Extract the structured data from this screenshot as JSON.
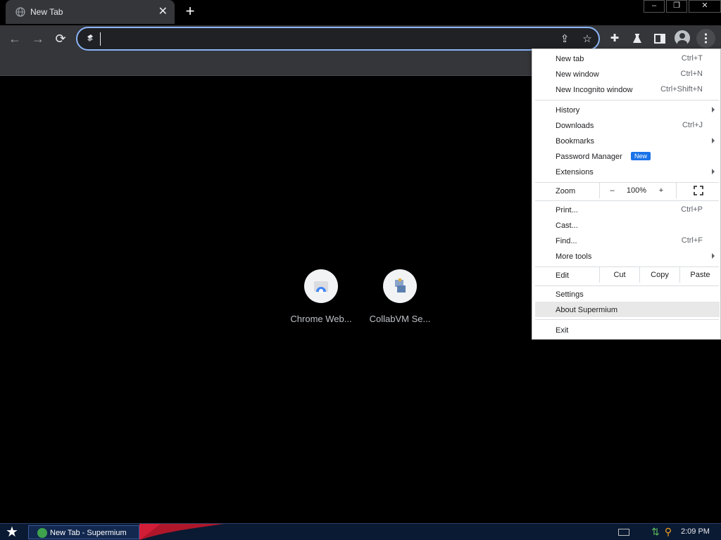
{
  "tab": {
    "title": "New Tab",
    "close": "✕"
  },
  "new_tab_plus": "+",
  "window_controls": {
    "minimize": "–",
    "restore": "❐",
    "close": "✕"
  },
  "omnibox": {
    "value": "",
    "placeholder": ""
  },
  "shortcuts": [
    {
      "label": "Chrome Web..."
    },
    {
      "label": "CollabVM Se..."
    }
  ],
  "menu": {
    "new_tab": {
      "label": "New tab",
      "shortcut": "Ctrl+T"
    },
    "new_window": {
      "label": "New window",
      "shortcut": "Ctrl+N"
    },
    "new_incognito": {
      "label": "New Incognito window",
      "shortcut": "Ctrl+Shift+N"
    },
    "history": {
      "label": "History"
    },
    "downloads": {
      "label": "Downloads",
      "shortcut": "Ctrl+J"
    },
    "bookmarks": {
      "label": "Bookmarks"
    },
    "password_manager": {
      "label": "Password Manager",
      "badge": "New"
    },
    "extensions": {
      "label": "Extensions"
    },
    "zoom": {
      "label": "Zoom",
      "minus": "–",
      "level": "100%",
      "plus": "+"
    },
    "print": {
      "label": "Print...",
      "shortcut": "Ctrl+P"
    },
    "cast": {
      "label": "Cast..."
    },
    "find": {
      "label": "Find...",
      "shortcut": "Ctrl+F"
    },
    "more_tools": {
      "label": "More tools"
    },
    "edit": {
      "label": "Edit",
      "cut": "Cut",
      "copy": "Copy",
      "paste": "Paste"
    },
    "settings": {
      "label": "Settings"
    },
    "about": {
      "label": "About Supermium"
    },
    "exit": {
      "label": "Exit"
    }
  },
  "taskbar": {
    "task_label": "New Tab - Supermium",
    "clock": "2:09 PM"
  },
  "colors": {
    "accent": "#8ab4f8",
    "badge": "#1a73e8",
    "toolbar": "#35363a"
  }
}
